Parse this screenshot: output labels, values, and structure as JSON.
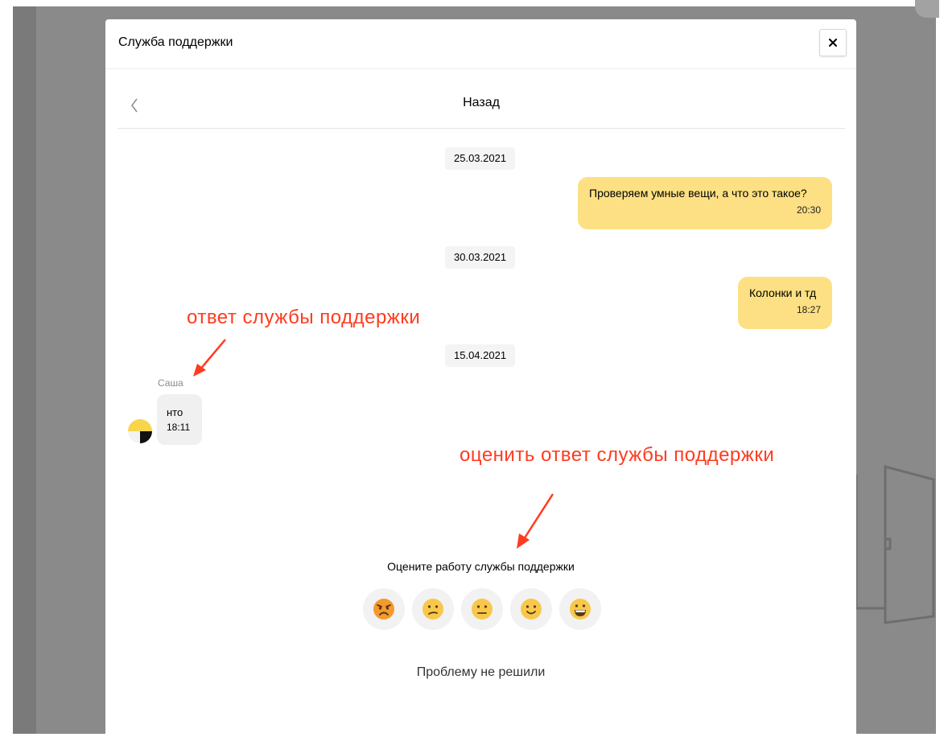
{
  "modal": {
    "title": "Служба поддержки",
    "close_label": "×"
  },
  "nav": {
    "back_title": "Назад"
  },
  "messages": {
    "date_1": "25.03.2021",
    "out_1": {
      "text": "Проверяем умные вещи, а что это такое?",
      "time": "20:30"
    },
    "date_2": "30.03.2021",
    "out_2": {
      "text": "Колонки и тд",
      "time": "18:27"
    },
    "date_3": "15.04.2021",
    "in_1": {
      "sender": "Саша",
      "text": "нто",
      "time": "18:11"
    }
  },
  "annotations": {
    "support_reply": "ответ службы поддержки",
    "rate_reply": "оценить ответ службы поддержки",
    "color": "#ff3b1f"
  },
  "rating": {
    "title": "Оцените работу службы поддержки",
    "options": [
      "angry-emoji",
      "confused-emoji",
      "neutral-emoji",
      "slight-smile-emoji",
      "grinning-emoji"
    ],
    "not_solved_label": "Проблему не решили"
  },
  "colors": {
    "outgoing_bubble": "#fce083",
    "incoming_bubble": "#f0f0f0",
    "overlay": "#8a8a8a"
  }
}
